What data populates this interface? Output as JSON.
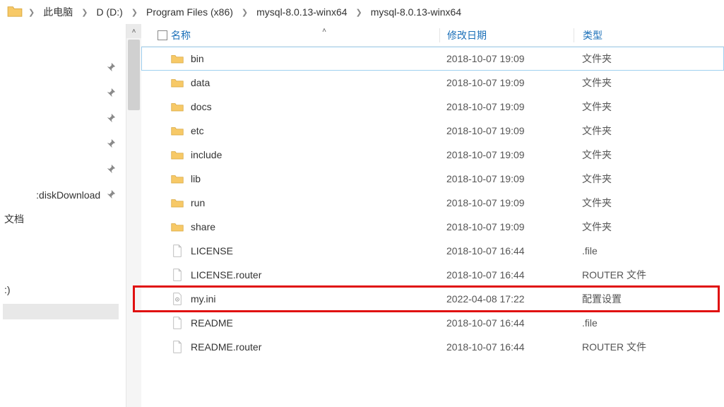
{
  "breadcrumb": {
    "items": [
      "此电脑",
      "D (D:)",
      "Program Files (x86)",
      "mysql-8.0.13-winx64",
      "mysql-8.0.13-winx64"
    ]
  },
  "sidebar": {
    "disk_download": ":diskDownload",
    "documents": "文档",
    "drive_label": ":)"
  },
  "columns": {
    "name": "名称",
    "date": "修改日期",
    "type": "类型"
  },
  "files": [
    {
      "icon": "folder",
      "name": "bin",
      "date": "2018-10-07 19:09",
      "type": "文件夹",
      "selected": true
    },
    {
      "icon": "folder",
      "name": "data",
      "date": "2018-10-07 19:09",
      "type": "文件夹",
      "selected": false
    },
    {
      "icon": "folder",
      "name": "docs",
      "date": "2018-10-07 19:09",
      "type": "文件夹",
      "selected": false
    },
    {
      "icon": "folder",
      "name": "etc",
      "date": "2018-10-07 19:09",
      "type": "文件夹",
      "selected": false
    },
    {
      "icon": "folder",
      "name": "include",
      "date": "2018-10-07 19:09",
      "type": "文件夹",
      "selected": false
    },
    {
      "icon": "folder",
      "name": "lib",
      "date": "2018-10-07 19:09",
      "type": "文件夹",
      "selected": false
    },
    {
      "icon": "folder",
      "name": "run",
      "date": "2018-10-07 19:09",
      "type": "文件夹",
      "selected": false
    },
    {
      "icon": "folder",
      "name": "share",
      "date": "2018-10-07 19:09",
      "type": "文件夹",
      "selected": false
    },
    {
      "icon": "file",
      "name": "LICENSE",
      "date": "2018-10-07 16:44",
      "type": ".file",
      "selected": false
    },
    {
      "icon": "file",
      "name": "LICENSE.router",
      "date": "2018-10-07 16:44",
      "type": "ROUTER 文件",
      "selected": false
    },
    {
      "icon": "ini",
      "name": "my.ini",
      "date": "2022-04-08 17:22",
      "type": "配置设置",
      "selected": false,
      "highlight": true
    },
    {
      "icon": "file",
      "name": "README",
      "date": "2018-10-07 16:44",
      "type": ".file",
      "selected": false
    },
    {
      "icon": "file",
      "name": "README.router",
      "date": "2018-10-07 16:44",
      "type": "ROUTER 文件",
      "selected": false
    }
  ]
}
